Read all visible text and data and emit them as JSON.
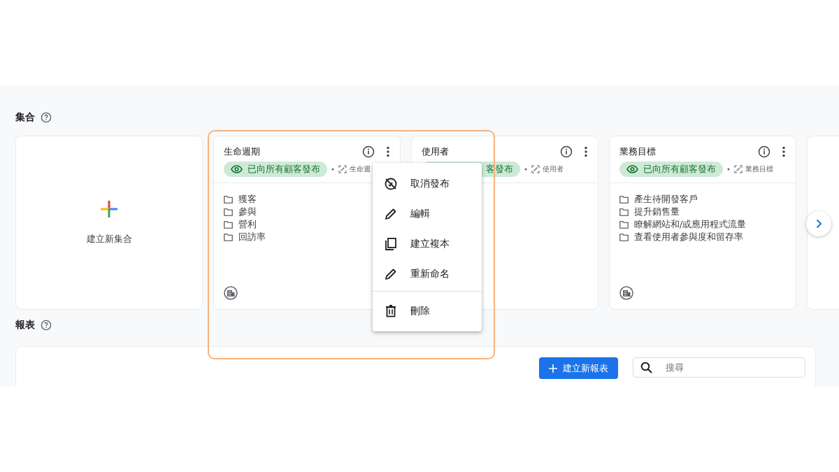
{
  "collections": {
    "title": "集合",
    "help": true,
    "create_card": {
      "label": "建立新集合"
    },
    "cards": [
      {
        "title": "生命週期",
        "status": {
          "label": "已向所有顧客發布",
          "icon": true
        },
        "source": "生命週",
        "folders": [
          "獲客",
          "參與",
          "營利",
          "回訪率"
        ],
        "footer_icon": true
      },
      {
        "title": "使用者",
        "status": {
          "label": "客發布",
          "icon": false
        },
        "source": "使用者",
        "footer_icon": false
      },
      {
        "title": "業務目標",
        "status": {
          "label": "已向所有顧客發布",
          "icon": true
        },
        "source": "業務目標",
        "folders": [
          "產生待開發客戶",
          "提升銷售量",
          "瞭解網站和/或應用程式流量",
          "查看使用者參與度和留存率"
        ],
        "footer_icon": true
      }
    ]
  },
  "context_menu": {
    "items": [
      {
        "kind": "unpublish",
        "label": "取消發布",
        "divider_before": false
      },
      {
        "kind": "edit",
        "label": "編輯",
        "divider_before": false
      },
      {
        "kind": "copy",
        "label": "建立複本",
        "divider_before": false
      },
      {
        "kind": "edit",
        "label": "重新命名",
        "divider_before": false
      },
      {
        "kind": "delete",
        "label": "刪除",
        "divider_before": true
      }
    ]
  },
  "reports": {
    "title": "報表",
    "help": true,
    "create_button": "建立新報表",
    "search": {
      "placeholder": "搜尋"
    }
  }
}
